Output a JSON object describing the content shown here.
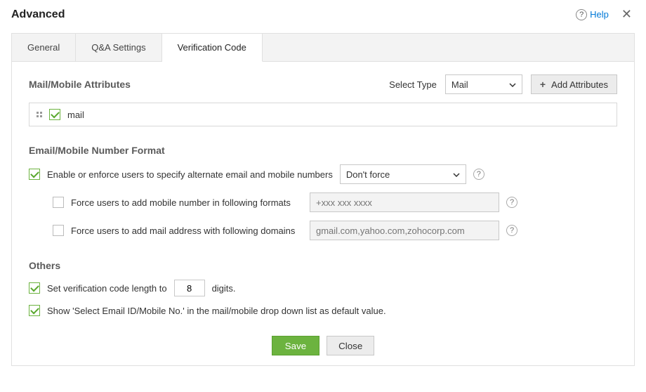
{
  "titlebar": {
    "title": "Advanced",
    "help_label": "Help"
  },
  "tabs": {
    "general": "General",
    "qa": "Q&A Settings",
    "verification": "Verification Code"
  },
  "mailmobile": {
    "heading": "Mail/Mobile Attributes",
    "select_type_label": "Select Type",
    "select_type_value": "Mail",
    "add_attributes_label": "Add Attributes",
    "items": [
      {
        "label": "mail",
        "checked": true
      }
    ]
  },
  "format": {
    "heading": "Email/Mobile Number Format",
    "enable_label": "Enable or enforce users to specify alternate email and mobile numbers",
    "force_select_value": "Don't force",
    "mobile_label": "Force users to add mobile number in following formats",
    "mobile_placeholder": "+xxx xxx xxxx",
    "mail_label": "Force users to add mail address with following domains",
    "mail_placeholder": "gmail.com,yahoo.com,zohocorp.com"
  },
  "others": {
    "heading": "Others",
    "code_len_prefix": "Set verification code length to",
    "code_len_value": "8",
    "code_len_suffix": "digits.",
    "default_dropdown_label": "Show 'Select Email ID/Mobile No.' in the mail/mobile drop down list as default value."
  },
  "footer": {
    "save": "Save",
    "close": "Close"
  }
}
